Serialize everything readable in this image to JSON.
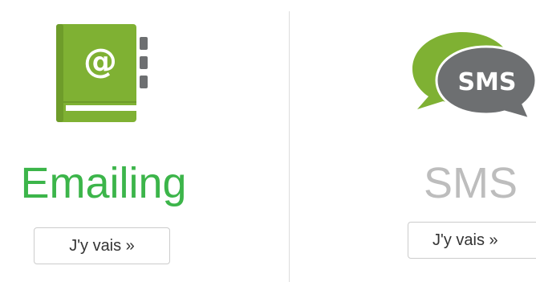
{
  "colors": {
    "accent_green": "#7fb133",
    "title_green": "#3cb54a",
    "sms_gray": "#6d6f71",
    "title_gray": "#bdbdbd"
  },
  "emailing": {
    "icon": "address-book-at-icon",
    "icon_glyph": "@",
    "title": "Emailing",
    "button_label": "J'y vais »"
  },
  "sms": {
    "icon": "sms-chat-bubbles-icon",
    "icon_text": "SMS",
    "title": "SMS",
    "button_label": "J'y vais »"
  }
}
